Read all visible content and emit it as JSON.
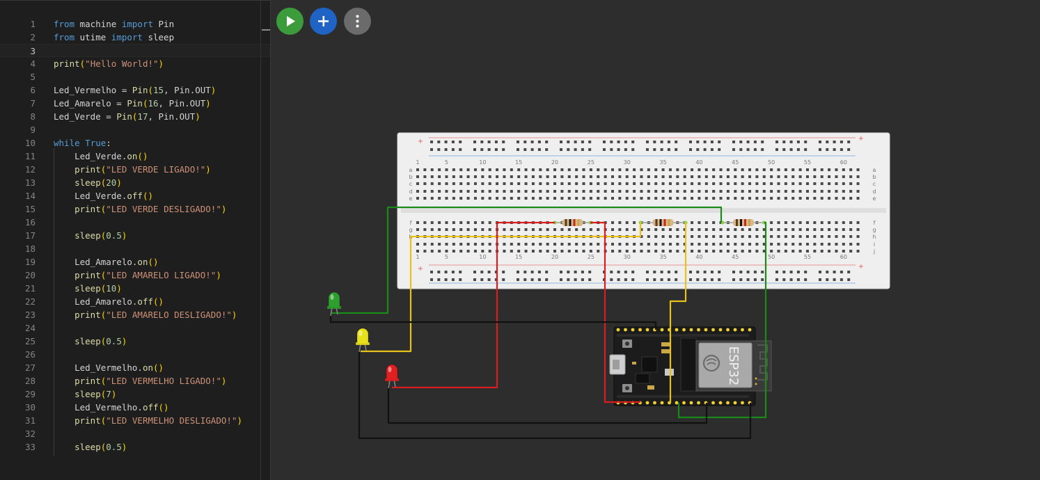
{
  "editor": {
    "current_line": 3,
    "lines": [
      {
        "n": "1",
        "tokens": [
          {
            "t": "from",
            "c": "kw"
          },
          {
            "t": " machine ",
            "c": ""
          },
          {
            "t": "import",
            "c": "kw"
          },
          {
            "t": " Pin",
            "c": ""
          }
        ]
      },
      {
        "n": "2",
        "tokens": [
          {
            "t": "from",
            "c": "kw"
          },
          {
            "t": " utime ",
            "c": ""
          },
          {
            "t": "import",
            "c": "kw"
          },
          {
            "t": " sleep",
            "c": ""
          }
        ]
      },
      {
        "n": "3",
        "tokens": []
      },
      {
        "n": "4",
        "tokens": [
          {
            "t": "print",
            "c": "fn"
          },
          {
            "t": "(",
            "c": "br"
          },
          {
            "t": "\"Hello World!\"",
            "c": "str"
          },
          {
            "t": ")",
            "c": "br"
          }
        ]
      },
      {
        "n": "5",
        "tokens": []
      },
      {
        "n": "6",
        "tokens": [
          {
            "t": "Led_Vermelho = ",
            "c": ""
          },
          {
            "t": "Pin",
            "c": "fn"
          },
          {
            "t": "(",
            "c": "br"
          },
          {
            "t": "15",
            "c": "num"
          },
          {
            "t": ", Pin.OUT",
            "c": ""
          },
          {
            "t": ")",
            "c": "br"
          }
        ]
      },
      {
        "n": "7",
        "tokens": [
          {
            "t": "Led_Amarelo = ",
            "c": ""
          },
          {
            "t": "Pin",
            "c": "fn"
          },
          {
            "t": "(",
            "c": "br"
          },
          {
            "t": "16",
            "c": "num"
          },
          {
            "t": ", Pin.OUT",
            "c": ""
          },
          {
            "t": ")",
            "c": "br"
          }
        ]
      },
      {
        "n": "8",
        "tokens": [
          {
            "t": "Led_Verde = ",
            "c": ""
          },
          {
            "t": "Pin",
            "c": "fn"
          },
          {
            "t": "(",
            "c": "br"
          },
          {
            "t": "17",
            "c": "num"
          },
          {
            "t": ", Pin.OUT",
            "c": ""
          },
          {
            "t": ")",
            "c": "br"
          }
        ]
      },
      {
        "n": "9",
        "tokens": []
      },
      {
        "n": "10",
        "tokens": [
          {
            "t": "while",
            "c": "kw"
          },
          {
            "t": " ",
            "c": ""
          },
          {
            "t": "True",
            "c": "kw"
          },
          {
            "t": ":",
            "c": ""
          }
        ]
      },
      {
        "n": "11",
        "tokens": [
          {
            "t": "    Led_Verde.",
            "c": ""
          },
          {
            "t": "on",
            "c": "fn"
          },
          {
            "t": "()",
            "c": "br"
          }
        ]
      },
      {
        "n": "12",
        "tokens": [
          {
            "t": "    ",
            "c": ""
          },
          {
            "t": "print",
            "c": "fn"
          },
          {
            "t": "(",
            "c": "br"
          },
          {
            "t": "\"LED VERDE LIGADO!\"",
            "c": "str"
          },
          {
            "t": ")",
            "c": "br"
          }
        ]
      },
      {
        "n": "13",
        "tokens": [
          {
            "t": "    ",
            "c": ""
          },
          {
            "t": "sleep",
            "c": "fn"
          },
          {
            "t": "(",
            "c": "br"
          },
          {
            "t": "20",
            "c": "num"
          },
          {
            "t": ")",
            "c": "br"
          }
        ]
      },
      {
        "n": "14",
        "tokens": [
          {
            "t": "    Led_Verde.",
            "c": ""
          },
          {
            "t": "off",
            "c": "fn"
          },
          {
            "t": "()",
            "c": "br"
          }
        ]
      },
      {
        "n": "15",
        "tokens": [
          {
            "t": "    ",
            "c": ""
          },
          {
            "t": "print",
            "c": "fn"
          },
          {
            "t": "(",
            "c": "br"
          },
          {
            "t": "\"LED VERDE DESLIGADO!\"",
            "c": "str"
          },
          {
            "t": ")",
            "c": "br"
          }
        ]
      },
      {
        "n": "16",
        "tokens": []
      },
      {
        "n": "17",
        "tokens": [
          {
            "t": "    ",
            "c": ""
          },
          {
            "t": "sleep",
            "c": "fn"
          },
          {
            "t": "(",
            "c": "br"
          },
          {
            "t": "0.5",
            "c": "num"
          },
          {
            "t": ")",
            "c": "br"
          }
        ]
      },
      {
        "n": "18",
        "tokens": []
      },
      {
        "n": "19",
        "tokens": [
          {
            "t": "    Led_Amarelo.",
            "c": ""
          },
          {
            "t": "on",
            "c": "fn"
          },
          {
            "t": "()",
            "c": "br"
          }
        ]
      },
      {
        "n": "20",
        "tokens": [
          {
            "t": "    ",
            "c": ""
          },
          {
            "t": "print",
            "c": "fn"
          },
          {
            "t": "(",
            "c": "br"
          },
          {
            "t": "\"LED AMARELO LIGADO!\"",
            "c": "str"
          },
          {
            "t": ")",
            "c": "br"
          }
        ]
      },
      {
        "n": "21",
        "tokens": [
          {
            "t": "    ",
            "c": ""
          },
          {
            "t": "sleep",
            "c": "fn"
          },
          {
            "t": "(",
            "c": "br"
          },
          {
            "t": "10",
            "c": "num"
          },
          {
            "t": ")",
            "c": "br"
          }
        ]
      },
      {
        "n": "22",
        "tokens": [
          {
            "t": "    Led_Amarelo.",
            "c": ""
          },
          {
            "t": "off",
            "c": "fn"
          },
          {
            "t": "()",
            "c": "br"
          }
        ]
      },
      {
        "n": "23",
        "tokens": [
          {
            "t": "    ",
            "c": ""
          },
          {
            "t": "print",
            "c": "fn"
          },
          {
            "t": "(",
            "c": "br"
          },
          {
            "t": "\"LED AMARELO DESLIGADO!\"",
            "c": "str"
          },
          {
            "t": ")",
            "c": "br"
          }
        ]
      },
      {
        "n": "24",
        "tokens": []
      },
      {
        "n": "25",
        "tokens": [
          {
            "t": "    ",
            "c": ""
          },
          {
            "t": "sleep",
            "c": "fn"
          },
          {
            "t": "(",
            "c": "br"
          },
          {
            "t": "0.5",
            "c": "num"
          },
          {
            "t": ")",
            "c": "br"
          }
        ]
      },
      {
        "n": "26",
        "tokens": []
      },
      {
        "n": "27",
        "tokens": [
          {
            "t": "    Led_Vermelho.",
            "c": ""
          },
          {
            "t": "on",
            "c": "fn"
          },
          {
            "t": "()",
            "c": "br"
          }
        ]
      },
      {
        "n": "28",
        "tokens": [
          {
            "t": "    ",
            "c": ""
          },
          {
            "t": "print",
            "c": "fn"
          },
          {
            "t": "(",
            "c": "br"
          },
          {
            "t": "\"LED VERMELHO LIGADO!\"",
            "c": "str"
          },
          {
            "t": ")",
            "c": "br"
          }
        ]
      },
      {
        "n": "29",
        "tokens": [
          {
            "t": "    ",
            "c": ""
          },
          {
            "t": "sleep",
            "c": "fn"
          },
          {
            "t": "(",
            "c": "br"
          },
          {
            "t": "7",
            "c": "num"
          },
          {
            "t": ")",
            "c": "br"
          }
        ]
      },
      {
        "n": "30",
        "tokens": [
          {
            "t": "    Led_Vermelho.",
            "c": ""
          },
          {
            "t": "off",
            "c": "fn"
          },
          {
            "t": "()",
            "c": "br"
          }
        ]
      },
      {
        "n": "31",
        "tokens": [
          {
            "t": "    ",
            "c": ""
          },
          {
            "t": "print",
            "c": "fn"
          },
          {
            "t": "(",
            "c": "br"
          },
          {
            "t": "\"LED VERMELHO DESLIGADO!\"",
            "c": "str"
          },
          {
            "t": ")",
            "c": "br"
          }
        ]
      },
      {
        "n": "32",
        "tokens": []
      },
      {
        "n": "33",
        "tokens": [
          {
            "t": "    ",
            "c": ""
          },
          {
            "t": "sleep",
            "c": "fn"
          },
          {
            "t": "(",
            "c": "br"
          },
          {
            "t": "0.5",
            "c": "num"
          },
          {
            "t": ")",
            "c": "br"
          }
        ]
      }
    ]
  },
  "toolbar": {
    "run_icon": "play-icon",
    "add_icon": "plus-icon",
    "more_icon": "kebab-menu-icon"
  },
  "breadboard": {
    "column_numbers": [
      "1",
      "5",
      "10",
      "15",
      "20",
      "25",
      "30",
      "35",
      "40",
      "45",
      "50",
      "55",
      "60"
    ],
    "rows_top": [
      "a",
      "b",
      "c",
      "d",
      "e"
    ],
    "rows_bottom": [
      "f",
      "g",
      "h",
      "i",
      "j"
    ],
    "rail_plus": "+"
  },
  "board": {
    "chip_label": "ESP32"
  },
  "leds": [
    {
      "name": "led-green",
      "color": "#2e9e2e"
    },
    {
      "name": "led-yellow",
      "color": "#e8e01a"
    },
    {
      "name": "led-red",
      "color": "#e02020"
    }
  ],
  "colors": {
    "editor_bg": "#1e1e1e",
    "canvas_bg": "#2d2d2d",
    "run": "#3c9c3c",
    "add": "#1f63c4",
    "more": "#6b6b6b",
    "wire_green": "#1a8a1a",
    "wire_yellow": "#e8c21a",
    "wire_red": "#d91e1e",
    "wire_black": "#111111"
  }
}
